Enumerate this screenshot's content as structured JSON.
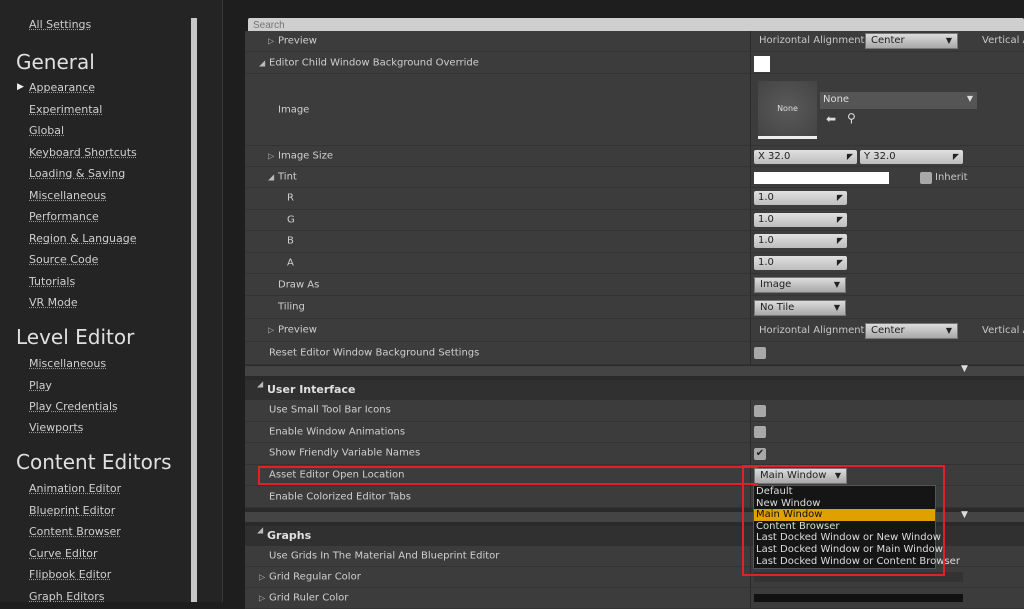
{
  "sidebar": {
    "all_settings": "All Settings",
    "sections": [
      {
        "title": "General",
        "items": [
          "Appearance",
          "Experimental",
          "Global",
          "Keyboard Shortcuts",
          "Loading & Saving",
          "Miscellaneous",
          "Performance",
          "Region & Language",
          "Source Code",
          "Tutorials",
          "VR Mode"
        ],
        "selected": "Appearance"
      },
      {
        "title": "Level Editor",
        "items": [
          "Miscellaneous",
          "Play",
          "Play Credentials",
          "Viewports"
        ]
      },
      {
        "title": "Content Editors",
        "items": [
          "Animation Editor",
          "Blueprint Editor",
          "Content Browser",
          "Curve Editor",
          "Flipbook Editor",
          "Graph Editors"
        ]
      }
    ]
  },
  "search": {
    "placeholder": "Search"
  },
  "properties": {
    "preview_1": "Preview",
    "child_bg": "Editor Child Window Background Override",
    "image": "Image",
    "image_size": "Image Size",
    "tint": "Tint",
    "r": "R",
    "g": "G",
    "b": "B",
    "a": "A",
    "draw_as": "Draw As",
    "tiling": "Tiling",
    "preview_2": "Preview",
    "reset": "Reset Editor Window Background Settings"
  },
  "values": {
    "horizontal_alignment": "Horizontal Alignment",
    "horizontal_alignment_value": "Center",
    "vertical_alignment": "Vertical A",
    "thumbnail_text": "None",
    "asset_value": "None",
    "size_x_label": "X",
    "size_x": "32.0",
    "size_y_label": "Y",
    "size_y": "32.0",
    "inherit": "Inherit",
    "r": "1.0",
    "g": "1.0",
    "b": "1.0",
    "a": "1.0",
    "draw_as": "Image",
    "tiling": "No Tile"
  },
  "user_interface": {
    "title": "User Interface",
    "rows": [
      "Use Small Tool Bar Icons",
      "Enable Window Animations",
      "Show Friendly Variable Names",
      "Asset Editor Open Location",
      "Enable Colorized Editor Tabs"
    ],
    "checks": {
      "small_icons": false,
      "window_animations": false,
      "friendly_names": true
    },
    "open_location_value": "Main Window",
    "dropdown_options": [
      "Default",
      "New Window",
      "Main Window",
      "Content Browser",
      "Last Docked Window or New Window",
      "Last Docked Window or Main Window",
      "Last Docked Window or Content Browser"
    ],
    "dropdown_selected": "Main Window"
  },
  "graphs": {
    "title": "Graphs",
    "rows": [
      "Use Grids In The Material And Blueprint Editor",
      "Grid Regular Color",
      "Grid Ruler Color"
    ]
  },
  "colors": {
    "highlight": "#e0a000",
    "annotation": "#e0202a"
  }
}
